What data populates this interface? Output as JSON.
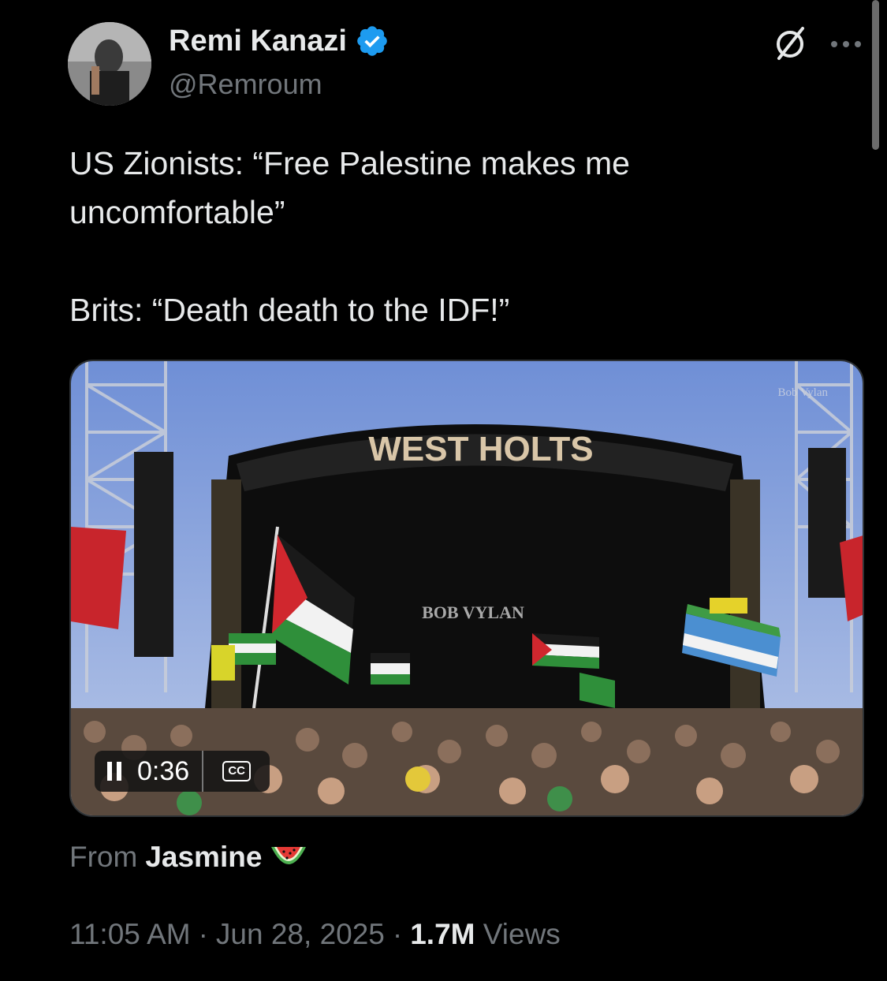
{
  "author": {
    "display_name": "Remi Kanazi",
    "handle": "@Remroum",
    "verified": true,
    "verified_color": "#1d9bf0"
  },
  "icons": [
    "grok-icon",
    "more-icon",
    "verified-badge-icon",
    "pause-icon",
    "closed-captions-icon",
    "watermelon-icon"
  ],
  "tweet": {
    "text": "US Zionists: “Free Palestine makes me uncomfortable”\n\nBrits: “Death death to the IDF!”"
  },
  "video": {
    "time": "0:36",
    "cc_label": "CC",
    "banner_text": "WEST HOLTS",
    "stage_text": "BOB VYLAN",
    "watermark": "Bob Vylan"
  },
  "attribution": {
    "prefix": "From",
    "name": "Jasmine",
    "emoji": "🍉"
  },
  "meta": {
    "time": "11:05 AM",
    "sep1": "·",
    "date": "Jun 28, 2025",
    "sep2": "·",
    "views_count": "1.7M",
    "views_label": "Views"
  }
}
